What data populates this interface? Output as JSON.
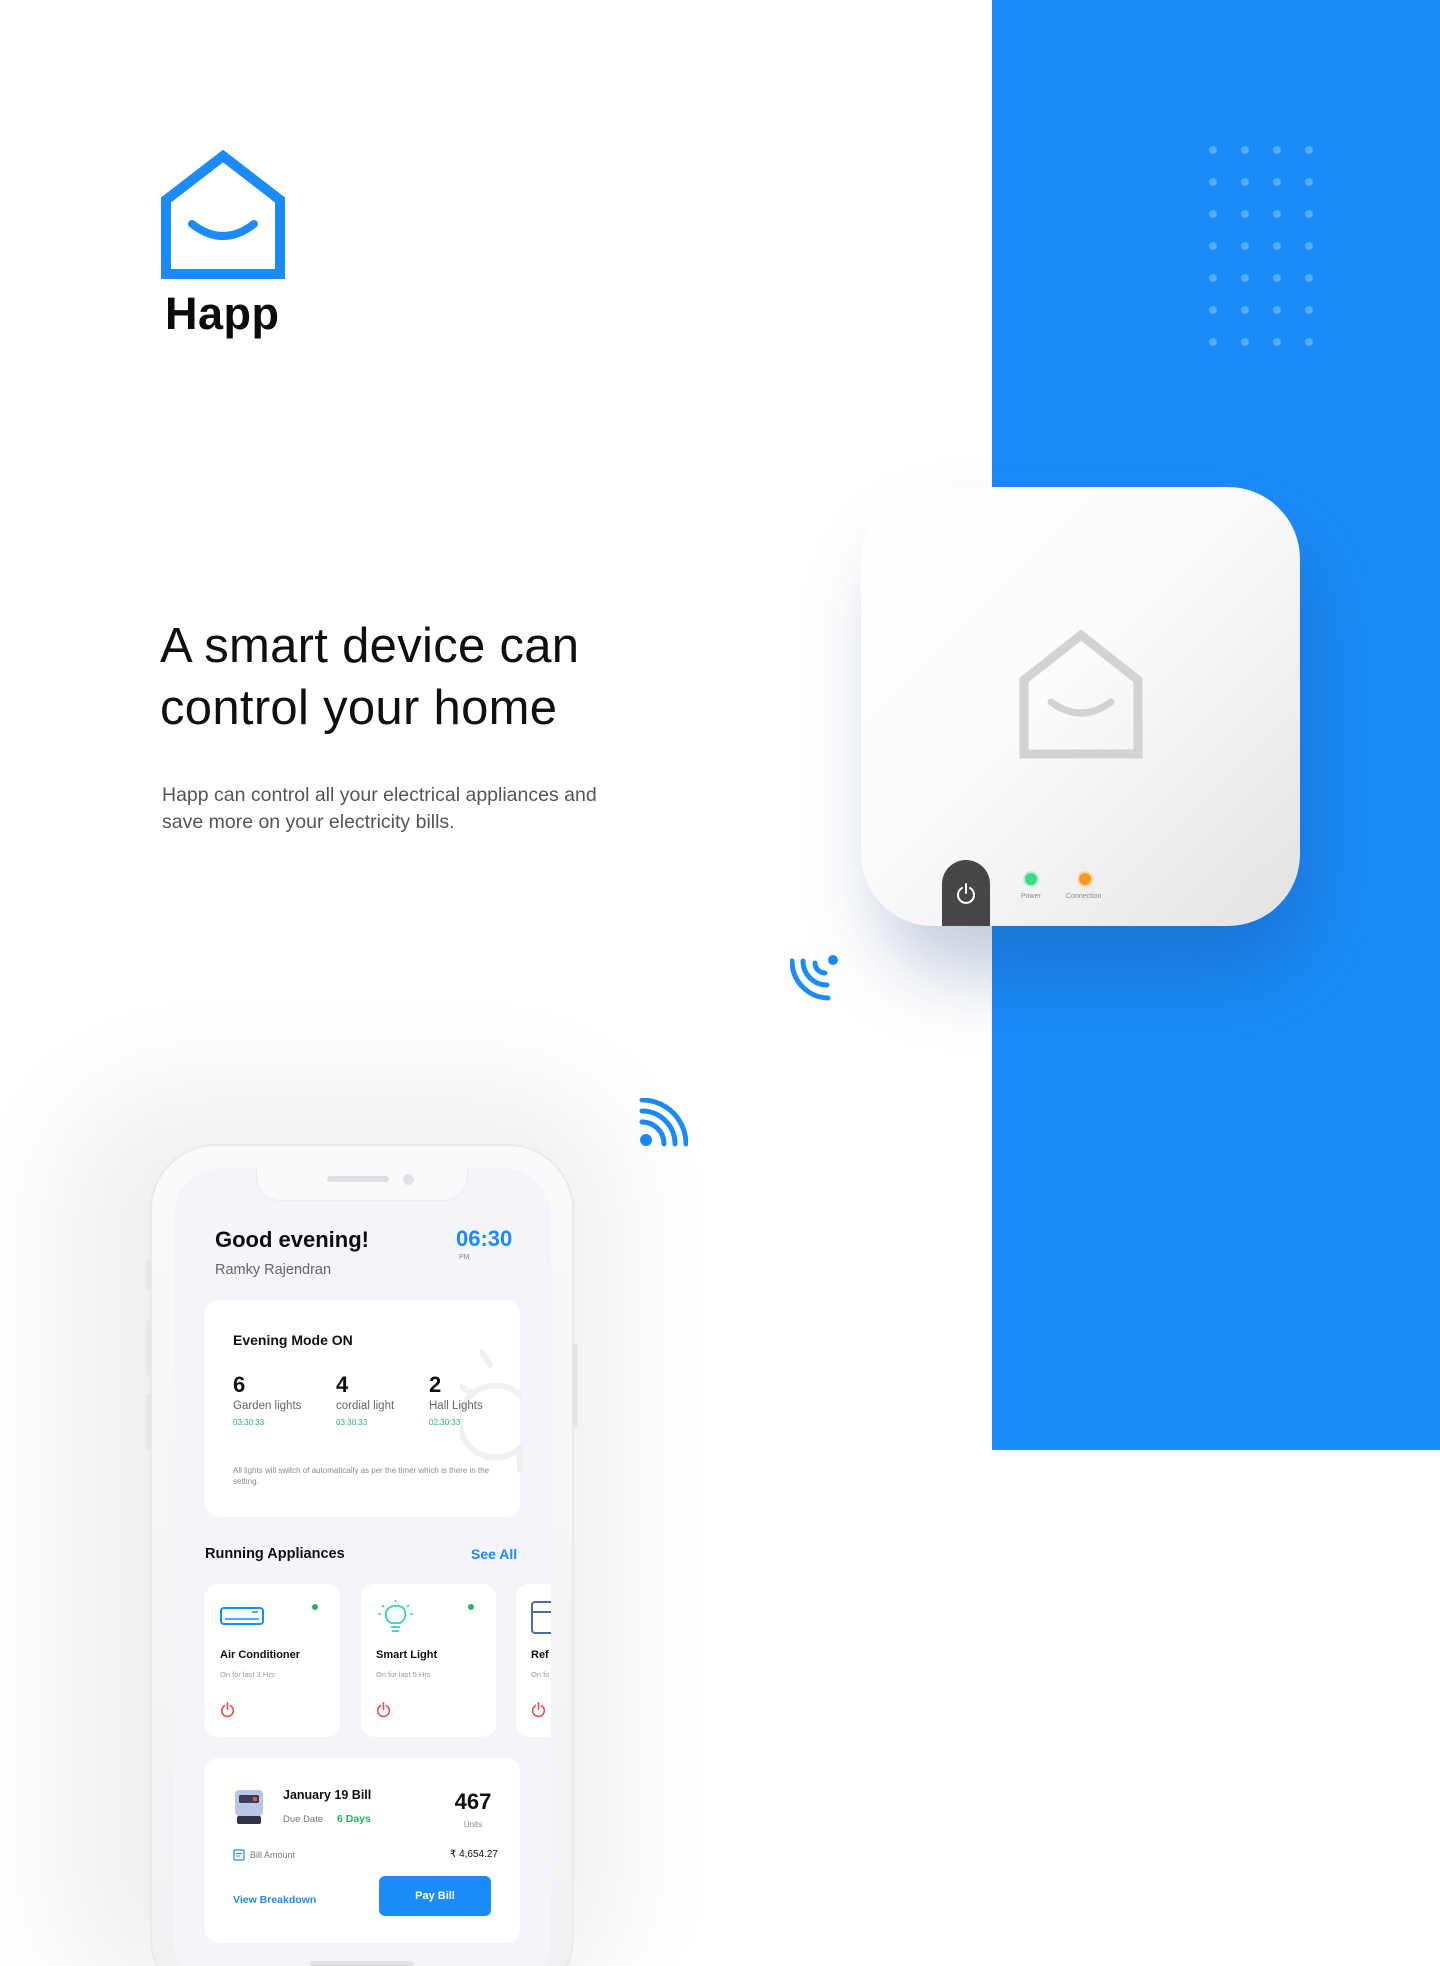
{
  "brand": {
    "name": "Happ"
  },
  "hero": {
    "headline": "A smart device can control your home",
    "description": "Happ can control all your electrical appliances and save more on your electricity bills."
  },
  "device": {
    "indicators": [
      {
        "label": "Power",
        "color": "#3ddc84"
      },
      {
        "label": "Connection",
        "color": "#f49a26"
      }
    ]
  },
  "phone": {
    "greeting": "Good evening!",
    "user_name": "Ramky Rajendran",
    "time": "06:30",
    "ampm": "PM",
    "mode_card": {
      "title": "Evening Mode ON",
      "stats": [
        {
          "count": "6",
          "label": "Garden lights",
          "timer": "03:30:33"
        },
        {
          "count": "4",
          "label": "cordial light",
          "timer": "03:30:33"
        },
        {
          "count": "2",
          "label": "Hall Lights",
          "timer": "02:30:33"
        }
      ],
      "note": "All lights will switch of automatically as per the timer which is there in the setting."
    },
    "appliances": {
      "title": "Running Appliances",
      "see_all": "See All",
      "items": [
        {
          "name": "Air Conditioner",
          "status": "On for last 3 Hrs",
          "icon": "air-conditioner-icon"
        },
        {
          "name": "Smart Light",
          "status": "On for last 5 Hrs",
          "icon": "light-bulb-icon"
        },
        {
          "name": "Ref",
          "status": "On fo",
          "icon": "refrigerator-icon"
        }
      ]
    },
    "bill": {
      "title": "January 19 Bill",
      "due_label": "Due Date",
      "due_value": "6 Days",
      "units": "467",
      "units_label": "Units",
      "amount_label": "Bill Amount",
      "amount_value": "₹ 4,654.27",
      "breakdown_link": "View Breakdown",
      "pay_button": "Pay Bill"
    }
  },
  "colors": {
    "accent": "#1b8bf9",
    "success": "#27b35a",
    "danger": "#ee4a4a"
  }
}
